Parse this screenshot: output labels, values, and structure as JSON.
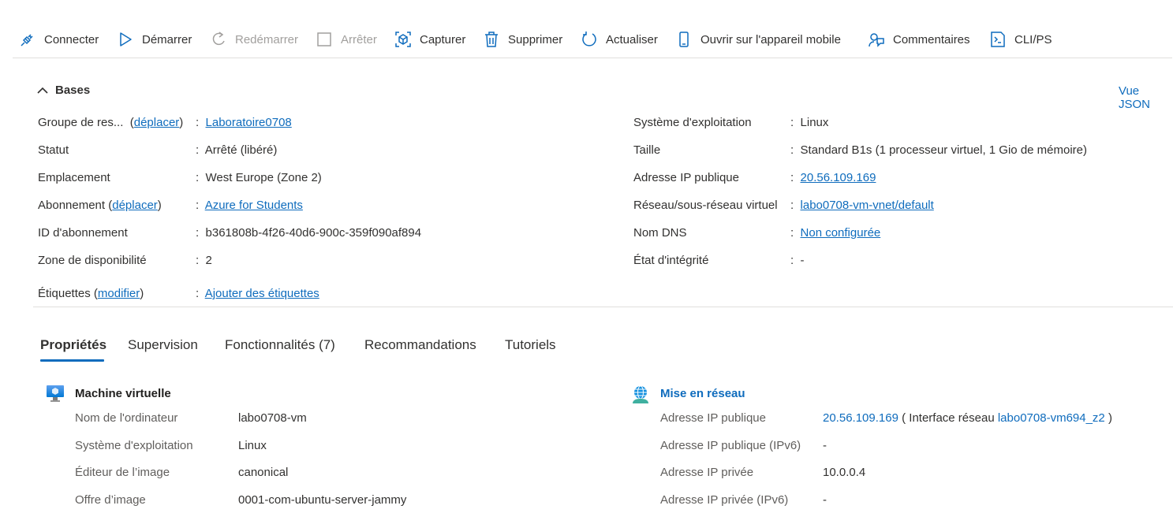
{
  "toolbar": {
    "connect": "Connecter",
    "start": "Démarrer",
    "restart": "Redémarrer",
    "stop": "Arrêter",
    "capture": "Capturer",
    "delete": "Supprimer",
    "refresh": "Actualiser",
    "mobile": "Ouvrir sur l'appareil mobile",
    "feedback": "Commentaires",
    "cli": "CLI/PS"
  },
  "essentials": {
    "title": "Bases",
    "json_view": "Vue JSON",
    "left": {
      "resource_group_label": "Groupe de res...",
      "resource_group_move": "déplacer",
      "resource_group_value": "Laboratoire0708",
      "status_label": "Statut",
      "status_value": "Arrêté (libéré)",
      "location_label": "Emplacement",
      "location_value": "West Europe (Zone 2)",
      "subscription_label": "Abonnement",
      "subscription_move": "déplacer",
      "subscription_value": "Azure for Students",
      "subscription_id_label": "ID d'abonnement",
      "subscription_id_value": "b361808b-4f26-40d6-900c-359f090af894",
      "zone_label": "Zone de disponibilité",
      "zone_value": "2",
      "tags_label": "Étiquettes",
      "tags_modify": "modifier",
      "tags_value": "Ajouter des étiquettes"
    },
    "right": {
      "os_label": "Système d'exploitation",
      "os_value": "Linux",
      "size_label": "Taille",
      "size_value": "Standard B1s (1 processeur virtuel, 1 Gio de mémoire)",
      "public_ip_label": "Adresse IP publique",
      "public_ip_value": "20.56.109.169",
      "vnet_label": "Réseau/sous-réseau virtuel",
      "vnet_value": "labo0708-vm-vnet/default",
      "dns_label": "Nom DNS",
      "dns_value": "Non configurée",
      "health_label": "État d'intégrité",
      "health_value": "-"
    }
  },
  "tabs": [
    "Propriétés",
    "Supervision",
    "Fonctionnalités (7)",
    "Recommandations",
    "Tutoriels"
  ],
  "vm_section": {
    "title": "Machine virtuelle",
    "rows": [
      {
        "label": "Nom de l'ordinateur",
        "value": "labo0708-vm"
      },
      {
        "label": "Système d'exploitation",
        "value": "Linux"
      },
      {
        "label": "Éditeur de l’image",
        "value": "canonical"
      },
      {
        "label": "Offre d’image",
        "value": "0001-com-ubuntu-server-jammy"
      }
    ]
  },
  "network_section": {
    "title": "Mise en réseau",
    "public_ip_label": "Adresse IP publique",
    "public_ip_value": "20.56.109.169",
    "nic_prefix": "( Interface réseau",
    "nic_value": "labo0708-vm694_z2",
    "nic_suffix": ")",
    "ipv6_public_label": "Adresse IP publique (IPv6)",
    "ipv6_public_value": "-",
    "private_ip_label": "Adresse IP privée",
    "private_ip_value": "10.0.0.4",
    "ipv6_private_label": "Adresse IP privée (IPv6)",
    "ipv6_private_value": "-"
  },
  "colors": {
    "accent": "#0f6cbd",
    "text": "#323130",
    "disabled": "#a19f9d"
  }
}
